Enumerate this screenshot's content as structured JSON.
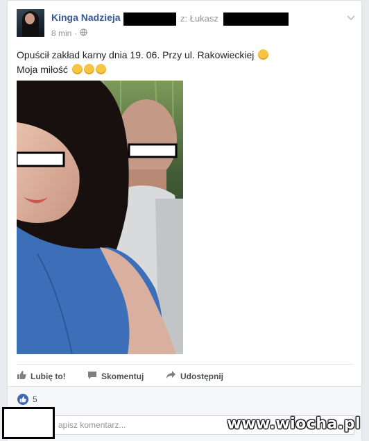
{
  "post": {
    "author": "Kinga Nadzieja",
    "with_prefix": "z: Łukasz",
    "time": "8 min",
    "privacy_icon": "globe-icon",
    "text_line1": "Opuścił zakład karny dnia 19. 06. Przy ul. Rakowieckiej",
    "text_line2": "Moja miłość",
    "emoji_line1": [
      "grinning-squint-emoji"
    ],
    "emoji_line2": [
      "heart-eyes-emoji",
      "kiss-emoji",
      "kiss-emoji"
    ]
  },
  "actions": {
    "like": "Lubię to!",
    "comment": "Skomentuj",
    "share": "Udostępnij"
  },
  "footer": {
    "like_count": "5",
    "comment_placeholder": "apisz komentarz..."
  },
  "watermark": "www.wiocha.pl",
  "colors": {
    "link": "#365899",
    "page_bg": "#e9ebee",
    "like_badge": "#4267b2"
  }
}
